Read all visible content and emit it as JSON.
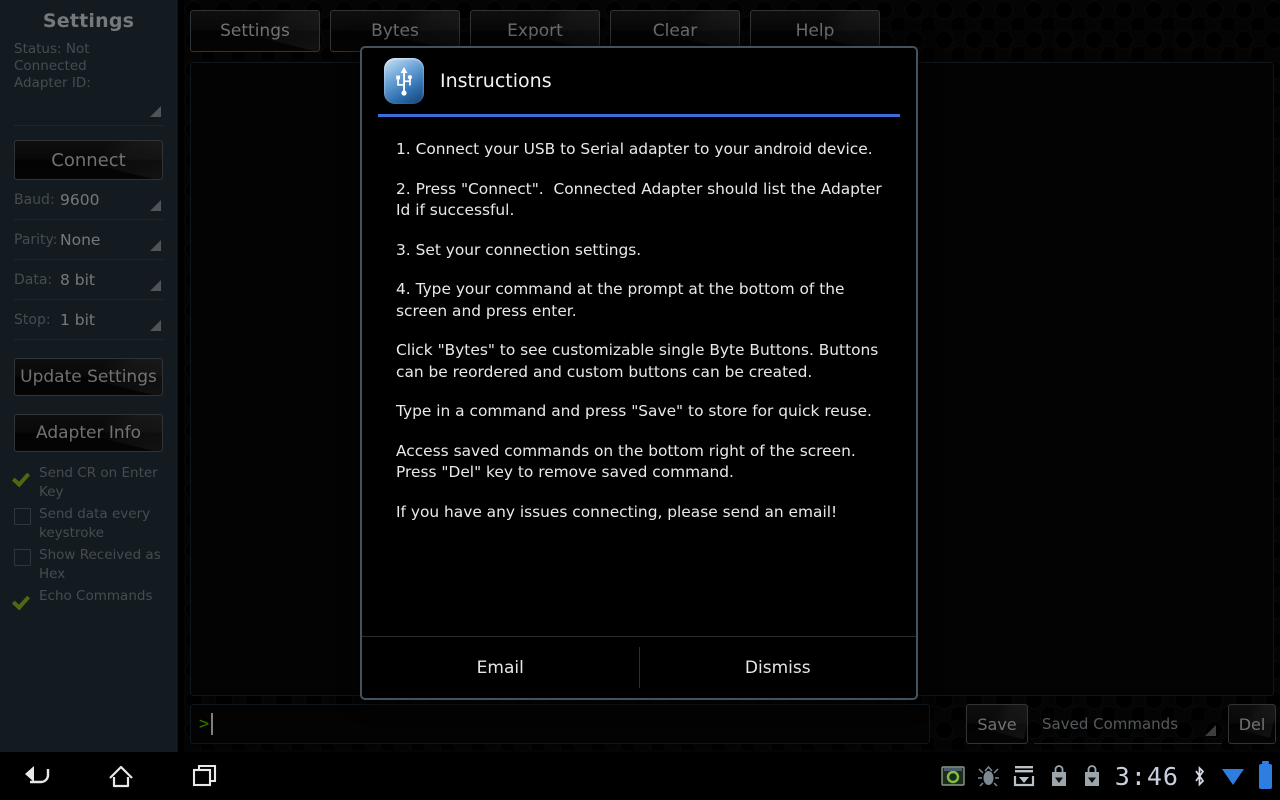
{
  "sidebar": {
    "title": "Settings",
    "status": "Status: Not Connected",
    "adapter_id": "Adapter ID:",
    "connect_label": "Connect",
    "update_label": "Update Settings",
    "adapter_info_label": "Adapter Info",
    "spinners": [
      {
        "label": "Baud:",
        "value": "9600"
      },
      {
        "label": "Parity:",
        "value": "None"
      },
      {
        "label": "Data:",
        "value": "8 bit"
      },
      {
        "label": "Stop:",
        "value": "1 bit"
      }
    ],
    "checkboxes": [
      {
        "label": "Send CR on Enter Key",
        "checked": true
      },
      {
        "label": "Send data every keystroke",
        "checked": false
      },
      {
        "label": "Show Received as Hex",
        "checked": false
      },
      {
        "label": "Echo Commands",
        "checked": true
      }
    ]
  },
  "tabs": [
    {
      "label": "Settings"
    },
    {
      "label": "Bytes"
    },
    {
      "label": "Export"
    },
    {
      "label": "Clear"
    },
    {
      "label": "Help"
    }
  ],
  "terminal": {
    "prompt": ">",
    "output": ""
  },
  "savebar": {
    "save_label": "Save",
    "saved_commands_label": "Saved Commands",
    "del_label": "Del"
  },
  "dialog": {
    "icon": "usb-serial-icon",
    "title": "Instructions",
    "paragraphs": [
      "1. Connect your USB to Serial adapter to your android device.",
      "2. Press \"Connect\".  Connected Adapter should list the Adapter Id if successful.",
      "3. Set your connection settings.",
      "4. Type your command at the prompt at the bottom of the screen and press enter.",
      "Click \"Bytes\" to see customizable single Byte Buttons. Buttons can be reordered and custom buttons can be created.",
      "Type in a command and press \"Save\" to store for quick reuse.",
      "Access saved commands on the bottom right of the screen. Press \"Del\" key to remove saved command.",
      "If you have any issues connecting, please send an email!"
    ],
    "email_label": "Email",
    "dismiss_label": "Dismiss",
    "accent_color": "#3b6ed8"
  },
  "system_bar": {
    "back": "back-icon",
    "home": "home-icon",
    "recents": "recent-apps-icon",
    "clock": "3:46",
    "status_icons": [
      "screenshot-icon",
      "usb-debug-icon",
      "download-tray-icon",
      "app-download-icon",
      "app-download-icon",
      "bluetooth-icon",
      "wifi-icon",
      "battery-icon"
    ]
  },
  "colors": {
    "sidebar_bg": "#24313b",
    "check_green": "#93c01f",
    "prompt_green": "#5fd000",
    "dialog_border": "#42535f"
  }
}
